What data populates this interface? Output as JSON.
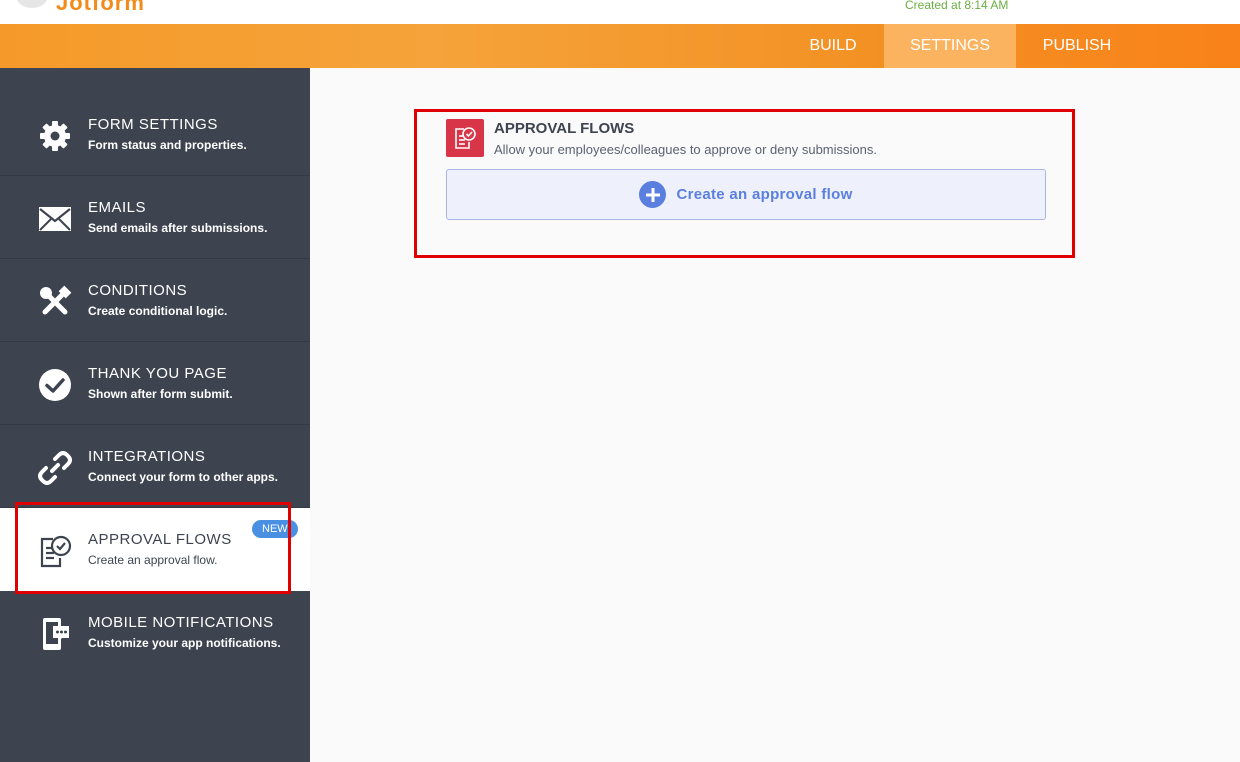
{
  "header": {
    "logo_text": "Jotform",
    "created_text": "Created at 8:14 AM"
  },
  "nav": {
    "tabs": [
      {
        "label": "BUILD",
        "active": false
      },
      {
        "label": "SETTINGS",
        "active": true
      },
      {
        "label": "PUBLISH",
        "active": false
      }
    ]
  },
  "sidebar": {
    "items": [
      {
        "title": "FORM SETTINGS",
        "subtitle": "Form status and properties.",
        "icon": "gear-icon"
      },
      {
        "title": "EMAILS",
        "subtitle": "Send emails after submissions.",
        "icon": "envelope-icon"
      },
      {
        "title": "CONDITIONS",
        "subtitle": "Create conditional logic.",
        "icon": "tools-icon"
      },
      {
        "title": "THANK YOU PAGE",
        "subtitle": "Shown after form submit.",
        "icon": "check-circle-icon"
      },
      {
        "title": "INTEGRATIONS",
        "subtitle": "Connect your form to other apps.",
        "icon": "link-icon"
      },
      {
        "title": "APPROVAL FLOWS",
        "subtitle": "Create an approval flow.",
        "icon": "approval-document-icon",
        "active": true,
        "badge": "NEW"
      },
      {
        "title": "MOBILE NOTIFICATIONS",
        "subtitle": "Customize your app notifications.",
        "icon": "mobile-chat-icon"
      }
    ]
  },
  "main": {
    "title": "APPROVAL FLOWS",
    "subtitle": "Allow your employees/colleagues to approve or deny submissions.",
    "create_button": "Create an approval flow"
  },
  "colors": {
    "accent_orange": "#f59a2a",
    "sidebar_bg": "#3e444f",
    "highlight_red": "#e00000",
    "button_blue": "#5b7fdf",
    "badge_blue": "#4a90e2",
    "panel_icon_red": "#d93548"
  }
}
